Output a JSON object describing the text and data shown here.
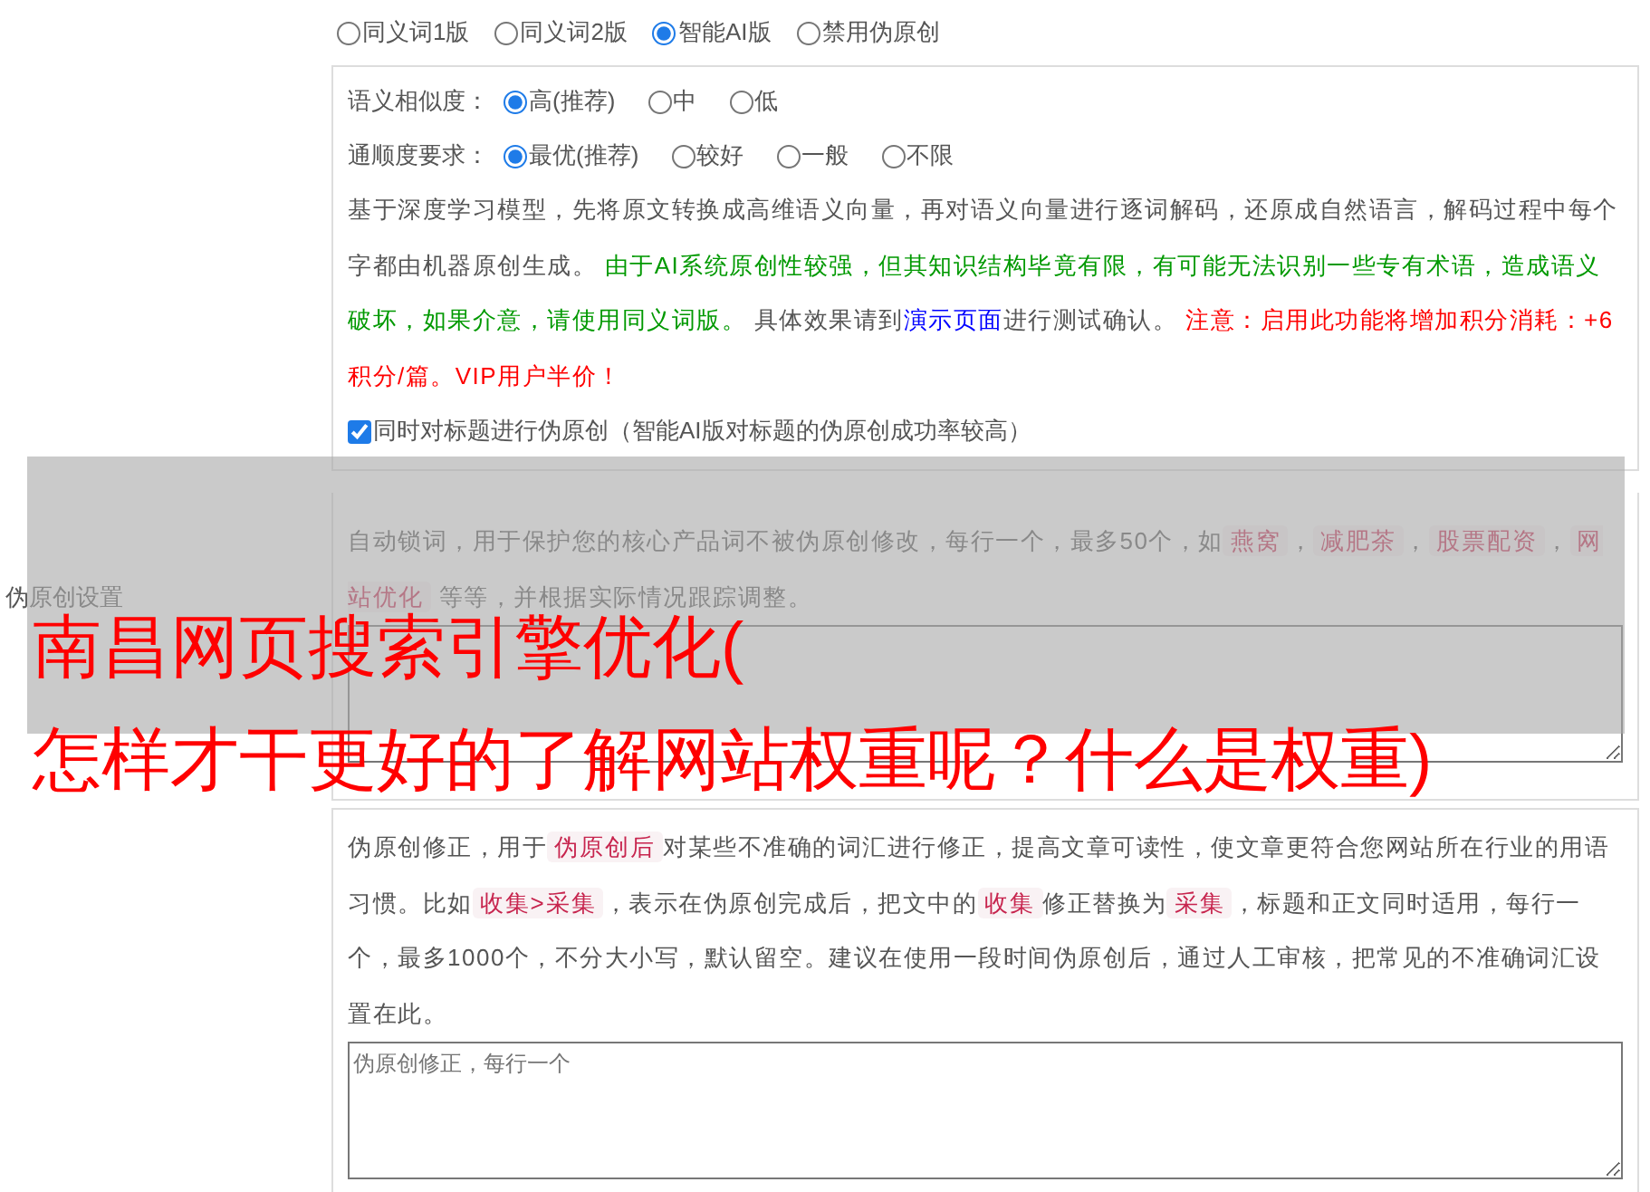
{
  "side_label": "伪原创设置",
  "mode_options": [
    {
      "label": "同义词1版",
      "selected": false
    },
    {
      "label": "同义词2版",
      "selected": false
    },
    {
      "label": "智能AI版",
      "selected": true
    },
    {
      "label": "禁用伪原创",
      "selected": false
    }
  ],
  "similarity": {
    "label": "语义相似度：",
    "options": [
      {
        "label": "高(推荐)",
        "selected": true
      },
      {
        "label": "中",
        "selected": false
      },
      {
        "label": "低",
        "selected": false
      }
    ]
  },
  "fluency": {
    "label": "通顺度要求：",
    "options": [
      {
        "label": "最优(推荐)",
        "selected": true
      },
      {
        "label": "较好",
        "selected": false
      },
      {
        "label": "一般",
        "selected": false
      },
      {
        "label": "不限",
        "selected": false
      }
    ]
  },
  "ai_description": [
    {
      "kind": "plain",
      "text": "基于深度学习模型，先将原文转换成高维语义向量，再对语义向量进行逐词解码，还原成自然语言，解码过程中每个字都由机器原创生成。 "
    },
    {
      "kind": "notice",
      "text": "由于AI系统原创性较强，但其知识结构毕竟有限，有可能无法识别一些专有术语，造成语义破坏，如果介意，请使用同义词版。"
    },
    {
      "kind": "plain",
      "text": " 具体效果请到"
    },
    {
      "kind": "link",
      "text": "演示页面"
    },
    {
      "kind": "plain",
      "text": "进行测试确认。 "
    },
    {
      "kind": "warning",
      "text": "注意：启用此功能将增加积分消耗：+6积分/篇。VIP用户半价！"
    }
  ],
  "title_option": {
    "label": "同时对标题进行伪原创（智能AI版对标题的伪原创成功率较高）",
    "checked": true
  },
  "lock_words": {
    "description": [
      {
        "kind": "plain",
        "text": "自动锁词，用于保护您的核心产品词不被伪原创修改，每行一个，最多50个，如"
      },
      {
        "kind": "code",
        "text": "燕窝"
      },
      {
        "kind": "plain",
        "text": "，"
      },
      {
        "kind": "code",
        "text": "减肥茶"
      },
      {
        "kind": "plain",
        "text": "，"
      },
      {
        "kind": "code",
        "text": "股票配资"
      },
      {
        "kind": "plain",
        "text": "，"
      },
      {
        "kind": "code",
        "text": "网站优化"
      },
      {
        "kind": "plain",
        "text": " 等等，并根据实际情况跟踪调整。"
      }
    ]
  },
  "correction": {
    "description": [
      {
        "kind": "plain",
        "text": "伪原创修正，用于"
      },
      {
        "kind": "code",
        "text": "伪原创后"
      },
      {
        "kind": "plain",
        "text": "对某些不准确的词汇进行修正，提高文章可读性，使文章更符合您网站所在行业的用语习惯。比如"
      },
      {
        "kind": "code",
        "text": "收集>采集"
      },
      {
        "kind": "plain",
        "text": "，表示在伪原创完成后，把文中的"
      },
      {
        "kind": "code",
        "text": "收集"
      },
      {
        "kind": "plain",
        "text": "修正替换为"
      },
      {
        "kind": "code",
        "text": "采集"
      },
      {
        "kind": "plain",
        "text": "，标题和正文同时适用，每行一个，最多1000个，不分大小写，默认留空。建议在使用一段时间伪原创后，通过人工审核，把常见的不准确词汇设置在此。"
      }
    ],
    "placeholder": "伪原创修正，每行一个"
  },
  "overlay": {
    "lines": [
      "南昌网页搜索引擎优化(",
      "怎样才干更好的了解网站权重呢？什么是权重)"
    ]
  }
}
